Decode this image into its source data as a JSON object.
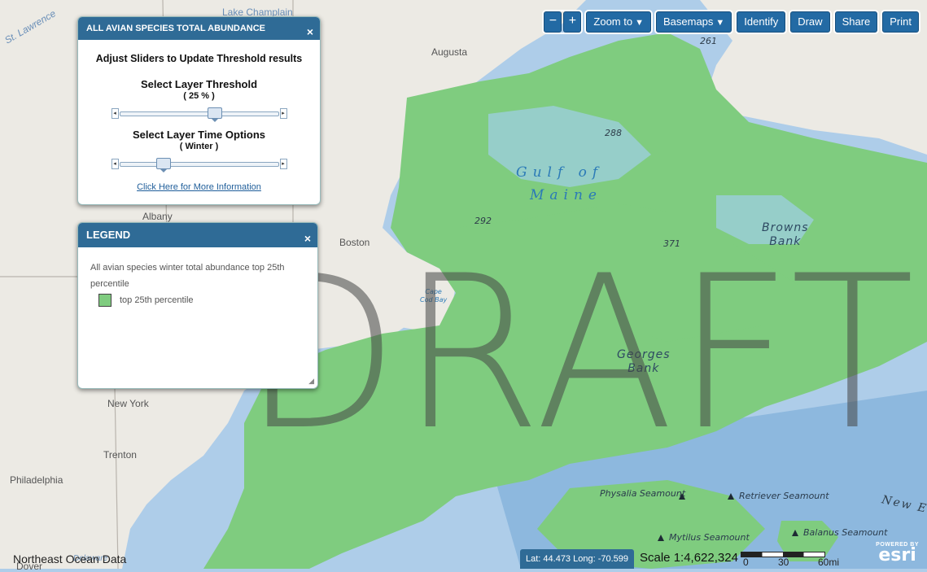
{
  "map": {
    "cities": [
      {
        "name": "Lake Champlain"
      },
      {
        "name": "St. Lawrence"
      },
      {
        "name": "Augusta"
      },
      {
        "name": "Albany"
      },
      {
        "name": "Boston"
      },
      {
        "name": "New York"
      },
      {
        "name": "Trenton"
      },
      {
        "name": "Philadelphia"
      },
      {
        "name": "Dover"
      },
      {
        "name": "Delaware"
      }
    ],
    "gulf_label_line1": "Gulf of",
    "gulf_label_line2": "Maine",
    "banks": [
      {
        "name": "Browns\nBank"
      },
      {
        "name": "Georges\nBank"
      },
      {
        "name": "Cape\nCod Bay"
      }
    ],
    "depths": [
      "261",
      "288",
      "292",
      "371"
    ],
    "seamounts": [
      {
        "name": "Physalia Seamount"
      },
      {
        "name": "Retriever Seamount"
      },
      {
        "name": "Mytilus Seamount"
      },
      {
        "name": "Balanus Seamount"
      }
    ],
    "new_england_label": "New E",
    "watermark": "DRAFT"
  },
  "toolbar": {
    "zoom_out": "−",
    "zoom_in": "+",
    "zoom_to": "Zoom to",
    "basemaps": "Basemaps",
    "identify": "Identify",
    "draw": "Draw",
    "share": "Share",
    "print": "Print",
    "caret": "▼"
  },
  "tool_panel": {
    "title": "ALL AVIAN SPECIES TOTAL ABUNDANCE",
    "close": "×",
    "subtitle": "Adjust Sliders to Update Threshold results",
    "threshold_label": "Select Layer Threshold",
    "threshold_value": "( 25 % )",
    "threshold_fraction": 0.6,
    "time_label": "Select Layer Time Options",
    "time_value": "( Winter )",
    "time_fraction": 0.25,
    "link": "Click Here for More Information"
  },
  "legend_panel": {
    "title": "LEGEND",
    "close": "×",
    "description": "All avian species winter total abundance top 25th percentile",
    "item_label": "top 25th percentile",
    "item_color": "#7fcc7f"
  },
  "footer": {
    "attribution": "Northeast Ocean Data",
    "coords": "Lat: 44.473  Long: -70.599",
    "scale": "Scale 1:4,622,324",
    "scale_ticks": [
      "0",
      "30",
      "60mi"
    ],
    "powered": "POWERED BY",
    "esri": "esri"
  },
  "colors": {
    "ocean": "#aecde9",
    "land": "#eceae4",
    "habitat": "#7fcc7f",
    "panel_header": "#2f6b96",
    "button": "#236aa4"
  }
}
